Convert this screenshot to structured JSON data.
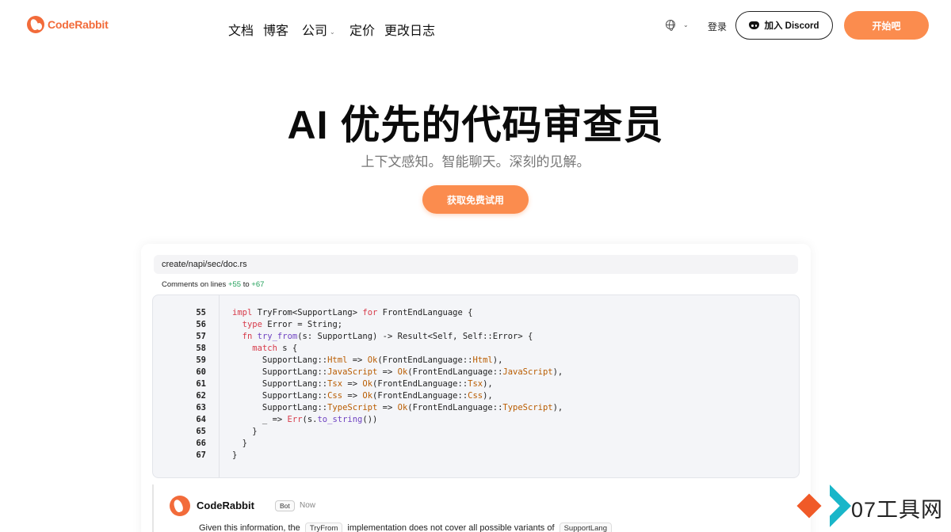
{
  "nav": {
    "logo_text": "CodeRabbit",
    "menu": [
      {
        "label": "文档",
        "dropdown": false
      },
      {
        "label": "博客",
        "dropdown": false
      },
      {
        "label": "公司",
        "dropdown": true
      },
      {
        "label": "定价",
        "dropdown": false
      },
      {
        "label": "更改日志",
        "dropdown": false
      }
    ],
    "login": "登录",
    "discord_label": "加入 Discord",
    "start_label": "开始吧"
  },
  "hero": {
    "title": "AI 优先的代码审查员",
    "subtitle": "上下文感知。智能聊天。深刻的见解。",
    "cta": "获取免费试用"
  },
  "review": {
    "file_path": "create/napi/sec/doc.rs",
    "comment_prefix": "Comments on lines ",
    "line_from": "+55",
    "line_to_word": " to ",
    "line_to": "+67",
    "code": [
      {
        "n": "55",
        "html": "<span class=\"kw\">impl</span> TryFrom&lt;SupportLang&gt; <span class=\"kw\">for</span> FrontEndLanguage {"
      },
      {
        "n": "56",
        "html": "  <span class=\"kw\">type</span> Error = String;"
      },
      {
        "n": "57",
        "html": "  <span class=\"kw\">fn</span> <span class=\"fn\">try_from</span>(s: SupportLang) -&gt; Result&lt;Self, Self::Error&gt; {"
      },
      {
        "n": "58",
        "html": "    <span class=\"kw\">match</span> s {"
      },
      {
        "n": "59",
        "html": "      SupportLang::<span class=\"ty\">Html</span> =&gt; <span class=\"ty\">Ok</span>(FrontEndLanguage::<span class=\"ty\">Html</span>),"
      },
      {
        "n": "60",
        "html": "      SupportLang::<span class=\"ty\">JavaScript</span> =&gt; <span class=\"ty\">Ok</span>(FrontEndLanguage::<span class=\"ty\">JavaScript</span>),"
      },
      {
        "n": "61",
        "html": "      SupportLang::<span class=\"ty\">Tsx</span> =&gt; <span class=\"ty\">Ok</span>(FrontEndLanguage::<span class=\"ty\">Tsx</span>),"
      },
      {
        "n": "62",
        "html": "      SupportLang::<span class=\"ty\">Css</span> =&gt; <span class=\"ty\">Ok</span>(FrontEndLanguage::<span class=\"ty\">Css</span>),"
      },
      {
        "n": "63",
        "html": "      SupportLang::<span class=\"ty\">TypeScript</span> =&gt; <span class=\"ty\">Ok</span>(FrontEndLanguage::<span class=\"ty\">TypeScript</span>),"
      },
      {
        "n": "64",
        "html": "      _ =&gt; <span class=\"kw\">Err</span>(s.<span class=\"fn\">to_string</span>())"
      },
      {
        "n": "65",
        "html": "    }"
      },
      {
        "n": "66",
        "html": "  }"
      },
      {
        "n": "67",
        "html": "}"
      }
    ]
  },
  "comment": {
    "author": "CodeRabbit",
    "badge": "Bot",
    "time": "Now",
    "text_before": "Given this information, the ",
    "chip1": "TryFrom",
    "text_mid": " implementation does not cover all possible variants of ",
    "chip2": "SupportLang"
  },
  "watermark": "07工具网",
  "colors": {
    "brand": "#f26b3a",
    "button": "#fb8c4e",
    "keyword": "#d73a49",
    "type": "#b95c00",
    "function": "#6f42c1",
    "added": "#22a05a"
  }
}
